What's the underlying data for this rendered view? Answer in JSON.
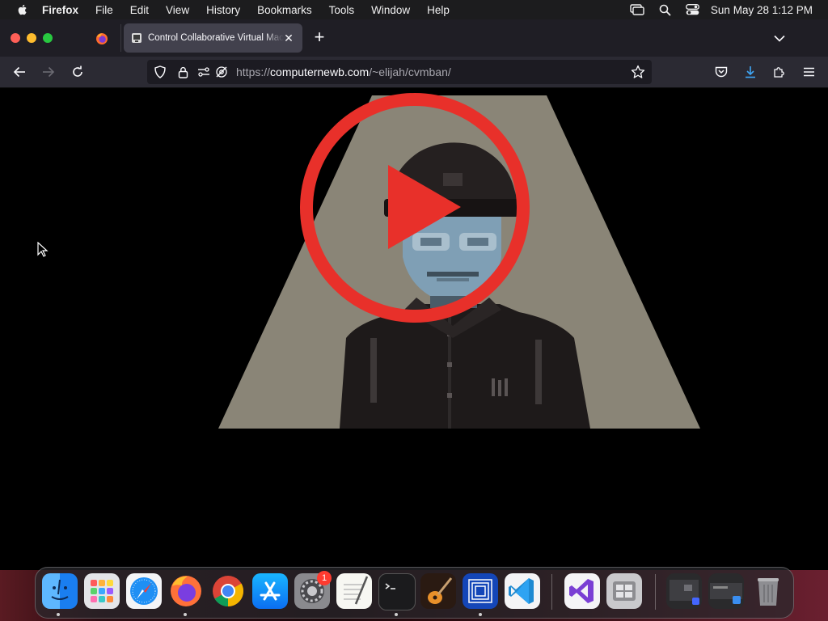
{
  "menubar": {
    "app_name": "Firefox",
    "menus": [
      "File",
      "Edit",
      "View",
      "History",
      "Bookmarks",
      "Tools",
      "Window",
      "Help"
    ],
    "clock": "Sun May 28  1:12 PM"
  },
  "tabs": {
    "active_title": "Control Collaborative Virtual Machine"
  },
  "urlbar": {
    "scheme": "https://",
    "host": "computernewb.com",
    "path": "/~elijah/cvmban/"
  },
  "dock": {
    "apps": [
      {
        "name": "Finder"
      },
      {
        "name": "Launchpad"
      },
      {
        "name": "Safari"
      },
      {
        "name": "Firefox"
      },
      {
        "name": "Google Chrome"
      },
      {
        "name": "App Store"
      },
      {
        "name": "System Settings",
        "badge": "1"
      },
      {
        "name": "TextEdit"
      },
      {
        "name": "Terminal"
      },
      {
        "name": "GarageBand"
      },
      {
        "name": "Simulator"
      },
      {
        "name": "Visual Studio Code"
      },
      {
        "name": "Visual Studio"
      },
      {
        "name": "Boot Camp Assistant"
      },
      {
        "name": "Window Minimized 1"
      },
      {
        "name": "Window Minimized 2"
      },
      {
        "name": "Trash"
      }
    ]
  },
  "colors": {
    "play_red": "#e8302a",
    "spotlight": "#8a8577",
    "face": "#7f9fb5"
  }
}
